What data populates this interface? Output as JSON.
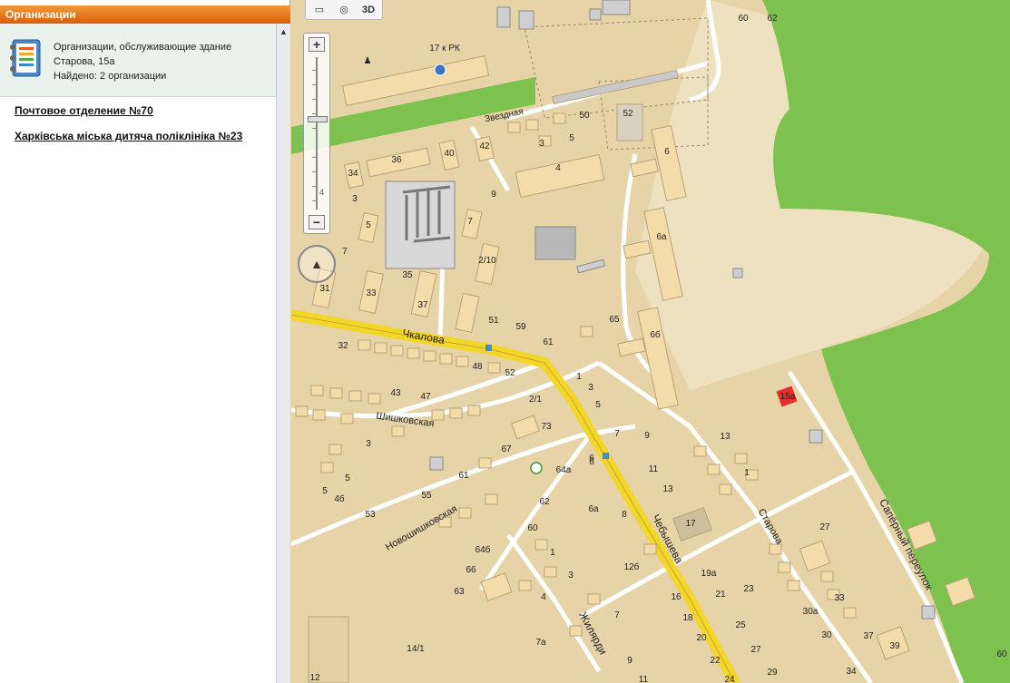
{
  "panel": {
    "title": "Организации",
    "info_lines": [
      "Организации, обслуживающие здание",
      "Старова, 15а",
      "Найдено: 2 организации"
    ],
    "organizations": [
      "Почтовое отделение №70",
      "Харківська міська дитяча поліклініка №23"
    ]
  },
  "toolbar": {
    "threed_label": "3D"
  },
  "zoom": {
    "plus": "+",
    "minus": "−",
    "scale_label": "4",
    "level": 0.6
  },
  "map": {
    "streets": [
      "Чкалова",
      "Звездная",
      "Шишковская",
      "Новошишковская",
      "Чебышева",
      "Старова",
      "Сапёрный переулок",
      "Жилярди"
    ],
    "poi_label": "17 к РК",
    "selected_building": "15а",
    "house_numbers": [
      "60",
      "62",
      "50",
      "52",
      "3",
      "5",
      "42",
      "36",
      "40",
      "34",
      "3",
      "4",
      "6",
      "9",
      "7",
      "5",
      "7",
      "2/10",
      "6а",
      "35",
      "31",
      "33",
      "37",
      "51",
      "59",
      "65",
      "61",
      "6б",
      "48",
      "52",
      "32",
      "43",
      "47",
      "2/1",
      "1",
      "3",
      "5",
      "7",
      "9",
      "13",
      "3",
      "73",
      "67",
      "4б",
      "5",
      "61",
      "55",
      "53",
      "64а",
      "6",
      "6а",
      "62",
      "60",
      "64б",
      "66",
      "63",
      "1",
      "3",
      "4",
      "7а",
      "14/1",
      "12",
      "11",
      "13",
      "17",
      "8",
      "12б",
      "19а",
      "16",
      "18",
      "20",
      "22",
      "24",
      "21",
      "23",
      "25",
      "27",
      "29",
      "27",
      "30а",
      "33",
      "30",
      "34",
      "37",
      "39",
      "60",
      "6",
      "5",
      "7",
      "9",
      "11",
      "1"
    ],
    "colors": {
      "land": "#e6d3a7",
      "park": "#7dc24f",
      "road": "#ffffff",
      "main_road": "#f2d629",
      "building": "#f4dcaa",
      "selected": "#e03030"
    }
  }
}
